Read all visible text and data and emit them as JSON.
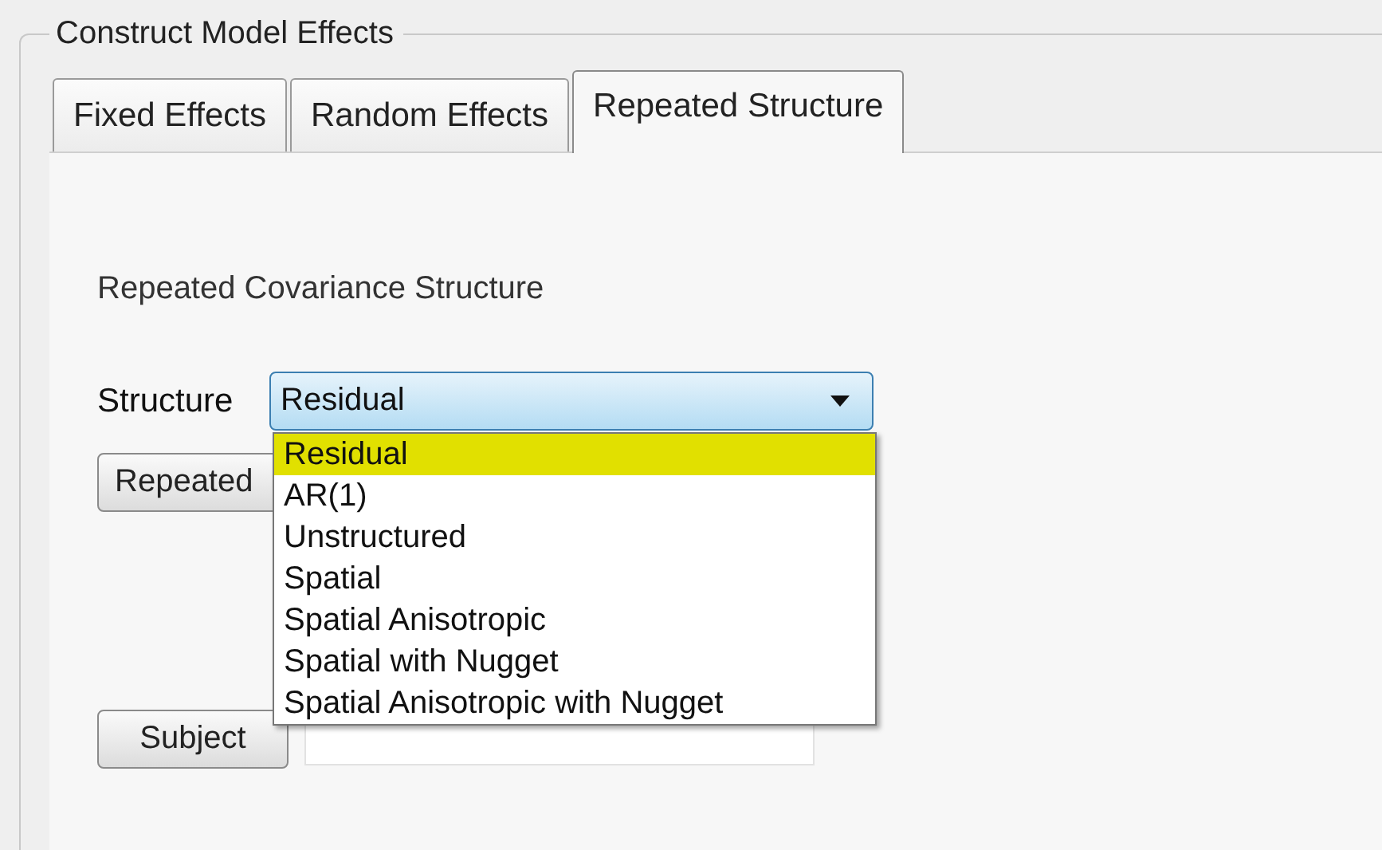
{
  "group": {
    "title": "Construct Model Effects"
  },
  "tabs": [
    {
      "label": "Fixed Effects",
      "selected": false
    },
    {
      "label": "Random Effects",
      "selected": false
    },
    {
      "label": "Repeated Structure",
      "selected": true
    }
  ],
  "section_title": "Repeated Covariance Structure",
  "structure": {
    "label": "Structure",
    "value": "Residual",
    "expanded": true,
    "options": [
      {
        "label": "Residual",
        "selected": true
      },
      {
        "label": "AR(1)",
        "selected": false
      },
      {
        "label": "Unstructured",
        "selected": false
      },
      {
        "label": "Spatial",
        "selected": false
      },
      {
        "label": "Spatial Anisotropic",
        "selected": false
      },
      {
        "label": "Spatial with Nugget",
        "selected": false
      },
      {
        "label": "Spatial Anisotropic with Nugget",
        "selected": false
      }
    ]
  },
  "repeated_button": {
    "label": "Repeated"
  },
  "subject": {
    "button": "Subject"
  }
}
